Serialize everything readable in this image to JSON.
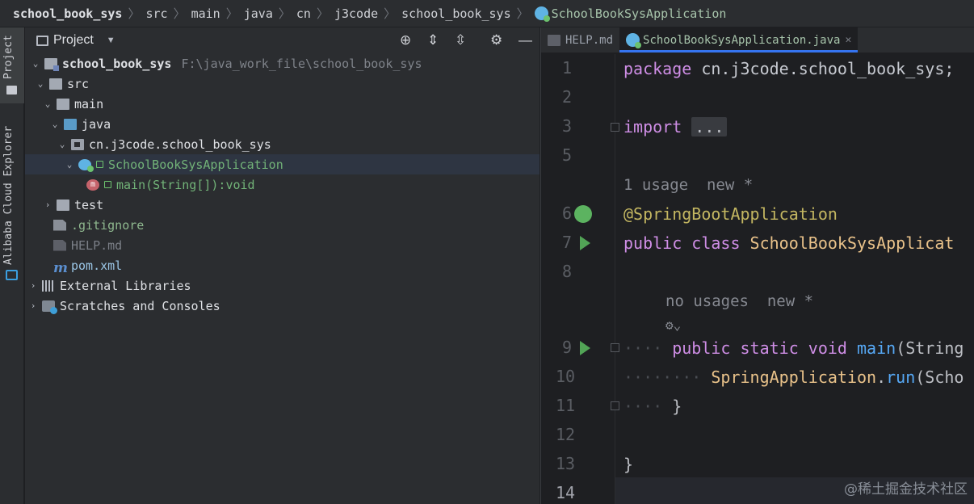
{
  "breadcrumb": [
    "school_book_sys",
    "src",
    "main",
    "java",
    "cn",
    "j3code",
    "school_book_sys",
    "SchoolBookSysApplication"
  ],
  "stripe": {
    "project_label": "Project",
    "alibaba_label": "Alibaba Cloud Explorer"
  },
  "panel": {
    "title": "Project"
  },
  "tree": [
    {
      "label": "school_book_sys",
      "extra": "F:\\java_work_file\\school_book_sys"
    },
    {
      "label": "src"
    },
    {
      "label": "main"
    },
    {
      "label": "java"
    },
    {
      "label": "cn.j3code.school_book_sys"
    },
    {
      "label": "SchoolBookSysApplication"
    },
    {
      "label": "main(String[]):void"
    },
    {
      "label": "test"
    },
    {
      "label": ".gitignore"
    },
    {
      "label": "HELP.md"
    },
    {
      "label": "pom.xml"
    },
    {
      "label": "External Libraries"
    },
    {
      "label": "Scratches and Consoles"
    }
  ],
  "tabs": [
    {
      "label": "HELP.md"
    },
    {
      "label": "SchoolBookSysApplication.java"
    }
  ],
  "editor": {
    "line_numbers": [
      "1",
      "2",
      "3",
      "5",
      "",
      "6",
      "7",
      "8",
      "",
      "",
      "9",
      "10",
      "11",
      "12",
      "13",
      "14"
    ],
    "code": {
      "l1_kw": "package",
      "l1_rest": " cn.j3code.school_book_sys;",
      "l3_kw": "import",
      "l3_fold": "...",
      "hint1": "1 usage  new *",
      "l6": "@SpringBootApplication",
      "l7_kw": "public class",
      "l7_cls": " SchoolBookSysApplicat",
      "hint2": "no usages  new *",
      "l9_kw": "public static void",
      "l9_fn": " main",
      "l9_rest": "(String",
      "l10_cls": "SpringApplication",
      "l10_dot": ".",
      "l10_fn": "run",
      "l10_rest": "(Scho",
      "l11": "}",
      "l13": "}"
    }
  },
  "watermark": "@稀土掘金技术社区",
  "colors": {
    "accent": "#3574f0",
    "run_green": "#52a456",
    "keyword": "#cf8ee6",
    "annotation": "#c3b661"
  }
}
